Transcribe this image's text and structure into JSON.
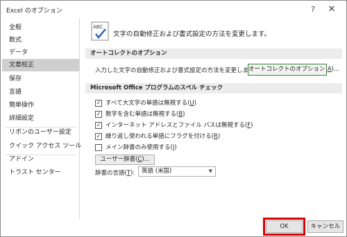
{
  "window": {
    "title": "Excel のオプション",
    "help_glyph": "?",
    "close_glyph": "✕"
  },
  "sidebar": {
    "items": [
      {
        "label": "全般"
      },
      {
        "label": "数式"
      },
      {
        "label": "データ"
      },
      {
        "label": "文章校正",
        "active": true
      },
      {
        "label": "保存"
      },
      {
        "label": "言語"
      },
      {
        "label": "簡単操作"
      },
      {
        "label": "詳細設定"
      },
      {
        "label": "リボンのユーザー設定"
      },
      {
        "label": "クイック アクセス ツール バー"
      },
      {
        "label": "アドイン"
      },
      {
        "label": "トラスト センター"
      }
    ]
  },
  "header": {
    "icon": "abc-proofing-icon",
    "icon_text": "ABC",
    "text": "文字の自動修正および書式設定の方法を変更します。"
  },
  "autocorrect_section": {
    "title": "オートコレクトのオプション",
    "label": "入力した文字の自動修正および書式設定の方法を変更します:",
    "button_prefix": "オートコレクトのオプション(",
    "button_key": "A",
    "button_suffix": ")..."
  },
  "spelling_section": {
    "title": "Microsoft Office プログラムのスペル チェック",
    "options": [
      {
        "prefix": "すべて大文字の単語は無視する(",
        "key": "U",
        "suffix": ")",
        "checked": true
      },
      {
        "prefix": "数字を含む単語は無視する(",
        "key": "B",
        "suffix": ")",
        "checked": true
      },
      {
        "prefix": "インターネット アドレスとファイル パスは無視する(",
        "key": "F",
        "suffix": ")",
        "checked": true
      },
      {
        "prefix": "繰り返し使われる単語にフラグを付ける(",
        "key": "R",
        "suffix": ")",
        "checked": true
      },
      {
        "prefix": "メイン辞書のみ使用する(",
        "key": "I",
        "suffix": ")",
        "checked": false
      }
    ],
    "dict_button_prefix": "ユーザー辞書(",
    "dict_button_key": "C",
    "dict_button_suffix": ")...",
    "language_label_prefix": "辞書の言語(",
    "language_label_key": "T",
    "language_label_suffix": "):",
    "language_value": "英語 (米国)"
  },
  "footer": {
    "ok_label": "OK",
    "cancel_label": "キャンセル",
    "highlight_color": "#d80000"
  }
}
